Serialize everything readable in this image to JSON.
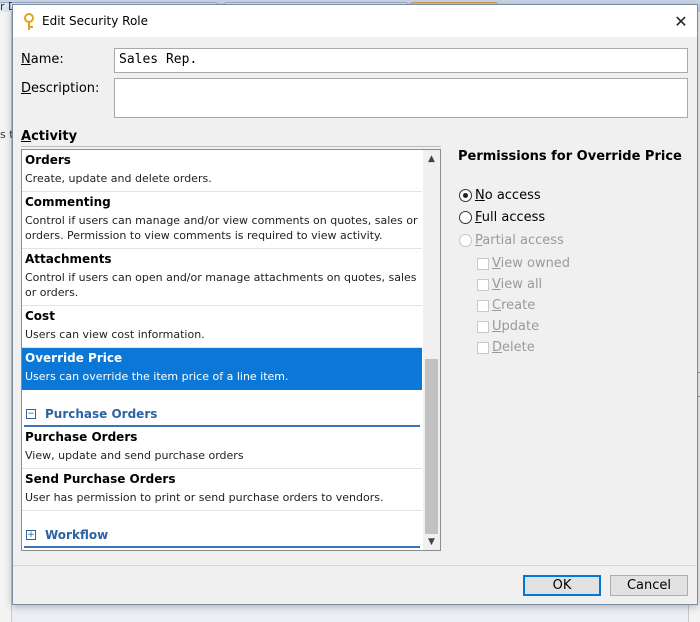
{
  "dialog": {
    "title": "Edit Security Role",
    "close_glyph": "✕"
  },
  "form": {
    "name_label_key": "N",
    "name_label_rest": "ame:",
    "name_value": "Sales Rep.",
    "description_label_key": "D",
    "description_label_rest": "escription:",
    "description_value": "",
    "activity_label_key": "A",
    "activity_label_rest": "ctivity"
  },
  "activities": {
    "items": [
      {
        "title": "Orders",
        "description": "Create, update and delete orders."
      },
      {
        "title": "Commenting",
        "description": "Control if users can manage and/or view comments on quotes, sales or orders. Permission to view comments is required to view activity."
      },
      {
        "title": "Attachments",
        "description": "Control if users can open and/or manage attachments on quotes, sales or orders."
      },
      {
        "title": "Cost",
        "description": "Users can view cost information."
      },
      {
        "title": "Override Price",
        "description": "Users can override the item price of a line item."
      }
    ],
    "selected": "Override Price",
    "groups": [
      {
        "label": "Purchase Orders",
        "toggle": "−",
        "items": [
          {
            "title": "Purchase Orders",
            "description": "View, update and send purchase orders"
          },
          {
            "title": "Send Purchase Orders",
            "description": "User has permission to print or send purchase orders to vendors."
          }
        ]
      },
      {
        "label": "Workflow",
        "toggle": "+"
      }
    ],
    "scroll_up_glyph": "▲",
    "scroll_down_glyph": "▼"
  },
  "permissions": {
    "title": "Permissions for Override Price",
    "options": [
      {
        "key": "N",
        "rest": "o access",
        "checked": true,
        "enabled": true
      },
      {
        "key": "F",
        "rest": "ull access",
        "checked": false,
        "enabled": true
      },
      {
        "key": "P",
        "rest": "artial access",
        "checked": false,
        "enabled": false
      }
    ],
    "partial": [
      {
        "key": "V",
        "rest": "iew owned"
      },
      {
        "key": "V",
        "rest": "iew all"
      },
      {
        "key": "C",
        "rest": "reate"
      },
      {
        "key": "U",
        "rest": "pdate"
      },
      {
        "key": "D",
        "rest": "elete"
      }
    ]
  },
  "buttons": {
    "ok": "OK",
    "cancel": "Cancel"
  },
  "background": {
    "left_fragment_1": "r D",
    "left_fragment_2": "s to"
  },
  "colors": {
    "selection": "#0b78d7",
    "group_link": "#2d62a3",
    "key_icon": "#e0a320"
  }
}
